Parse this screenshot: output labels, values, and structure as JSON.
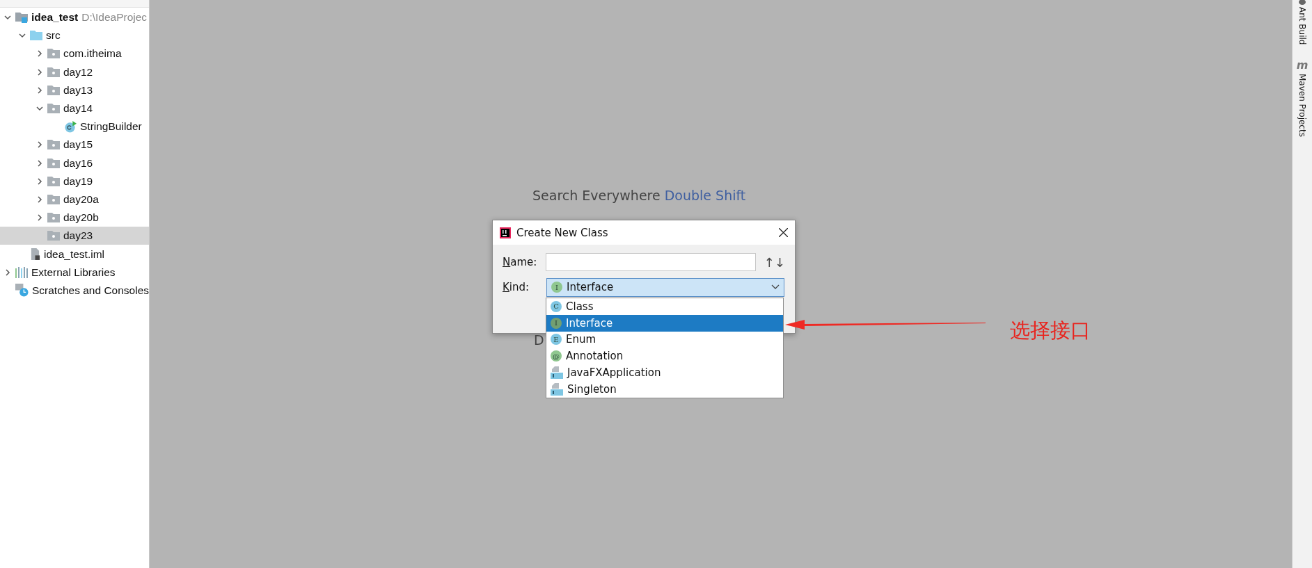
{
  "project_tree": [
    {
      "label": "idea_test",
      "path": "D:\\IdeaProjec",
      "kind": "module",
      "expanded": true,
      "selected": false,
      "children": [
        {
          "label": "src",
          "kind": "source-folder",
          "expanded": true,
          "selected": false,
          "children": [
            {
              "label": "com.itheima",
              "kind": "package",
              "expanded": false,
              "selected": false
            },
            {
              "label": "day12",
              "kind": "package",
              "expanded": false,
              "selected": false
            },
            {
              "label": "day13",
              "kind": "package",
              "expanded": false,
              "selected": false
            },
            {
              "label": "day14",
              "kind": "package",
              "expanded": true,
              "selected": false,
              "children": [
                {
                  "label": "StringBuilder",
                  "kind": "class",
                  "selected": false
                }
              ]
            },
            {
              "label": "day15",
              "kind": "package",
              "expanded": false,
              "selected": false
            },
            {
              "label": "day16",
              "kind": "package",
              "expanded": false,
              "selected": false
            },
            {
              "label": "day19",
              "kind": "package",
              "expanded": false,
              "selected": false
            },
            {
              "label": "day20a",
              "kind": "package",
              "expanded": false,
              "selected": false
            },
            {
              "label": "day20b",
              "kind": "package",
              "expanded": false,
              "selected": false
            },
            {
              "label": "day23",
              "kind": "package",
              "selected": true
            }
          ]
        },
        {
          "label": "idea_test.iml",
          "kind": "module-file",
          "selected": false
        }
      ]
    },
    {
      "label": "External Libraries",
      "kind": "libraries",
      "expanded": false,
      "selected": false
    },
    {
      "label": "Scratches and Consoles",
      "kind": "scratches",
      "selected": false
    }
  ],
  "editor": {
    "hint": "Search Everywhere",
    "hint_shortcut": "Double Shift",
    "hint_partial": "D"
  },
  "dialog": {
    "title": "Create New Class",
    "name_label": "Name:",
    "sort_glyph": "↑↓",
    "kind_label": "Kind:",
    "kind_value": {
      "label": "Interface",
      "kind": "interface",
      "letter": "I"
    },
    "options": [
      {
        "label": "Class",
        "kind": "class",
        "letter": "C",
        "selected": false
      },
      {
        "label": "Interface",
        "kind": "interface",
        "letter": "I",
        "selected": true
      },
      {
        "label": "Enum",
        "kind": "enum",
        "letter": "E",
        "selected": false
      },
      {
        "label": "Annotation",
        "kind": "annotation",
        "letter": "@",
        "selected": false
      },
      {
        "label": "JavaFXApplication",
        "kind": "template",
        "selected": false
      },
      {
        "label": "Singleton",
        "kind": "template",
        "selected": false
      }
    ]
  },
  "annotation": {
    "text": "选择接口"
  },
  "tool_windows": [
    {
      "label": "Ant Build",
      "kind": "ant"
    },
    {
      "label": "Maven Projects",
      "kind": "maven",
      "glyph": "m"
    }
  ]
}
